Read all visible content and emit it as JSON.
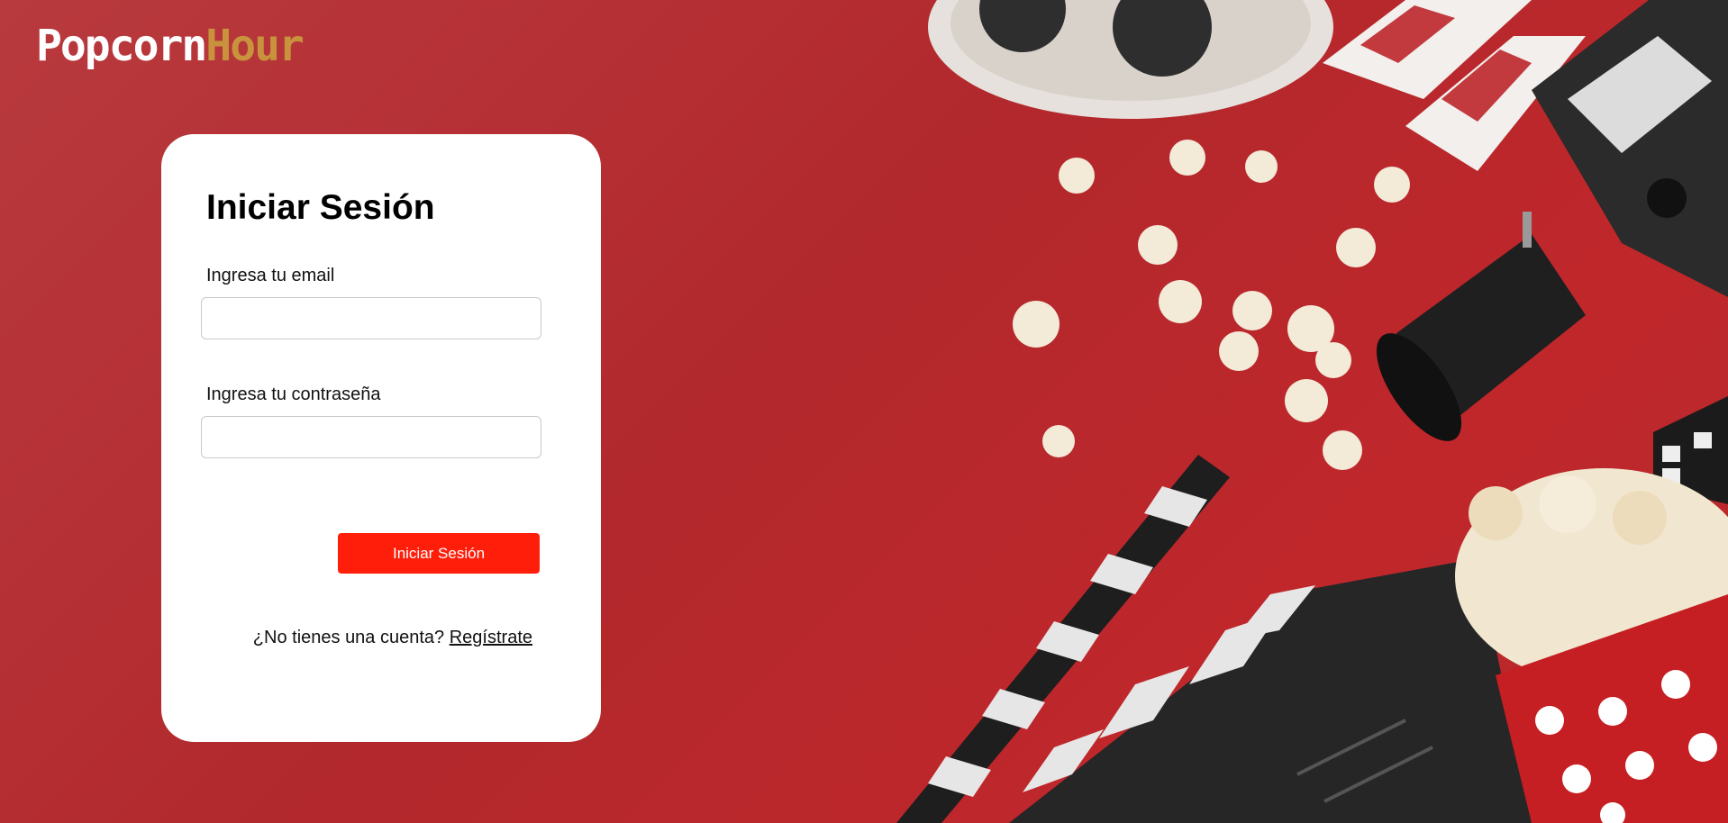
{
  "brand": {
    "name_part1": "Popcorn",
    "name_part2": "Hour"
  },
  "login": {
    "title": "Iniciar Sesión",
    "email_label": "Ingresa tu email",
    "email_value": "",
    "password_label": "Ingresa tu contraseña",
    "password_value": "",
    "submit_label": "Iniciar Sesión",
    "no_account_text": "¿No tienes una cuenta?",
    "register_link": "Regístrate"
  },
  "colors": {
    "background": "#b2282c",
    "brand_accent": "#c9933d",
    "button": "#ff1e0a"
  },
  "background_art": [
    "film-reel-icon",
    "3d-glasses-icon",
    "camera-icon",
    "popcorn-icon",
    "clapperboard-icon",
    "popcorn-bucket-icon"
  ]
}
